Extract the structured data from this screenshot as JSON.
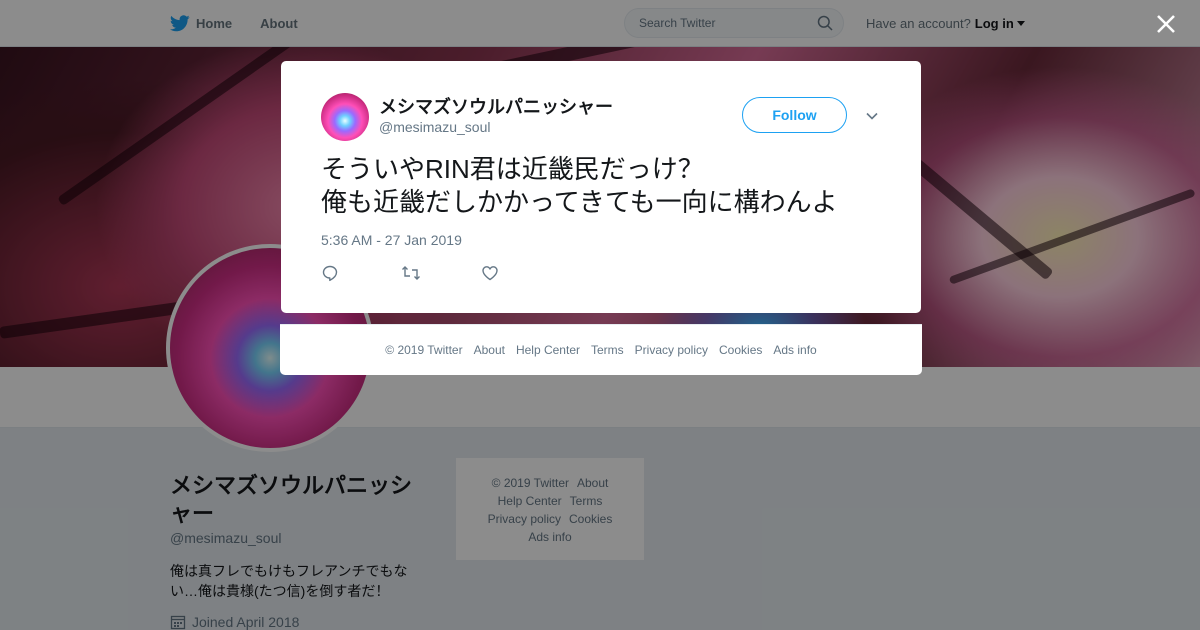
{
  "nav": {
    "home_label": "Home",
    "about_label": "About",
    "search_placeholder": "Search Twitter",
    "account_prompt": "Have an account?",
    "login_label": "Log in"
  },
  "profile": {
    "name": "メシマズソウルパニッシャー",
    "handle": "@mesimazu_soul",
    "bio": "俺は真フレでもけもフレアンチでもない…俺は貴様(たつ信)を倒す者だ！",
    "joined": "Joined April 2018"
  },
  "side_footer": {
    "line1": [
      "© 2019 Twitter",
      "About"
    ],
    "line2": [
      "Help Center",
      "Terms"
    ],
    "line3": [
      "Privacy policy",
      "Cookies"
    ],
    "line4": [
      "Ads info"
    ]
  },
  "tweet": {
    "author_name": "メシマズソウルパニッシャー",
    "author_handle": "@mesimazu_soul",
    "follow_label": "Follow",
    "text_line1": "そういやRIN君は近畿民だっけ？",
    "text_line2": "俺も近畿だしかかってきても一向に構わんよ",
    "timestamp": "5:36 AM - 27 Jan 2019"
  },
  "modal_footer": {
    "items": [
      "© 2019 Twitter",
      "About",
      "Help Center",
      "Terms",
      "Privacy policy",
      "Cookies",
      "Ads info"
    ]
  },
  "icons": {
    "bird": "twitter-bird-icon",
    "search": "search-icon",
    "close": "close-icon",
    "chevron": "chevron-down-icon",
    "reply": "reply-icon",
    "retweet": "retweet-icon",
    "like": "heart-icon",
    "calendar": "calendar-icon"
  },
  "colors": {
    "brand": "#1da1f2",
    "text_primary": "#14171a",
    "text_secondary": "#657786",
    "background": "#e6ecf0"
  }
}
